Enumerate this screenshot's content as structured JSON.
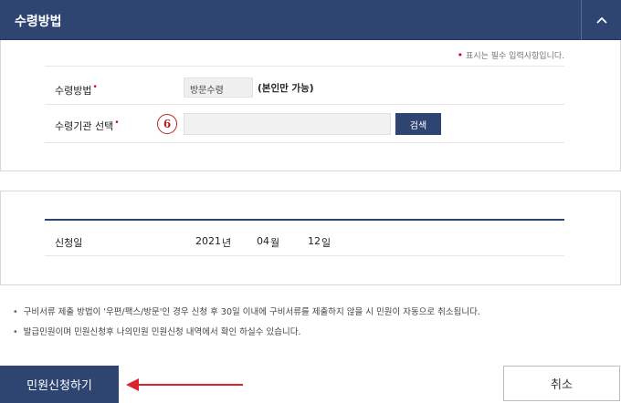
{
  "header": {
    "title": "수령방법",
    "collapse_icon": "chevron-up-icon"
  },
  "required_note": {
    "marker": "•",
    "text": "표시는 필수 입력사항입니다."
  },
  "form": {
    "method": {
      "label": "수령방법",
      "required_marker": "•",
      "value": "방문수령",
      "note": "(본인만 가능)"
    },
    "agency": {
      "label": "수령기관 선택",
      "required_marker": "•",
      "step_number": "6",
      "value": "",
      "search_button": "검색"
    }
  },
  "application_date": {
    "label": "신청일",
    "year": "2021",
    "year_unit": "년",
    "month": "04",
    "month_unit": "월",
    "day": "12",
    "day_unit": "일"
  },
  "notices": [
    "구비서류 제출 방법이 '우편/팩스/방문'인 경우 신청 후 30일 이내에 구비서류를 제출하지 않을 시 민원이 자동으로 취소됩니다.",
    "발급민원이며 민원신청후 나의민원 민원신청 내역에서 확인 하실수 있습니다."
  ],
  "notice_bullet": "•",
  "buttons": {
    "submit": "민원신청하기",
    "cancel": "취소"
  },
  "colors": {
    "primary": "#2e4471",
    "required": "#d0021b",
    "annotation": "#b5232a",
    "arrow": "#d9232d"
  }
}
